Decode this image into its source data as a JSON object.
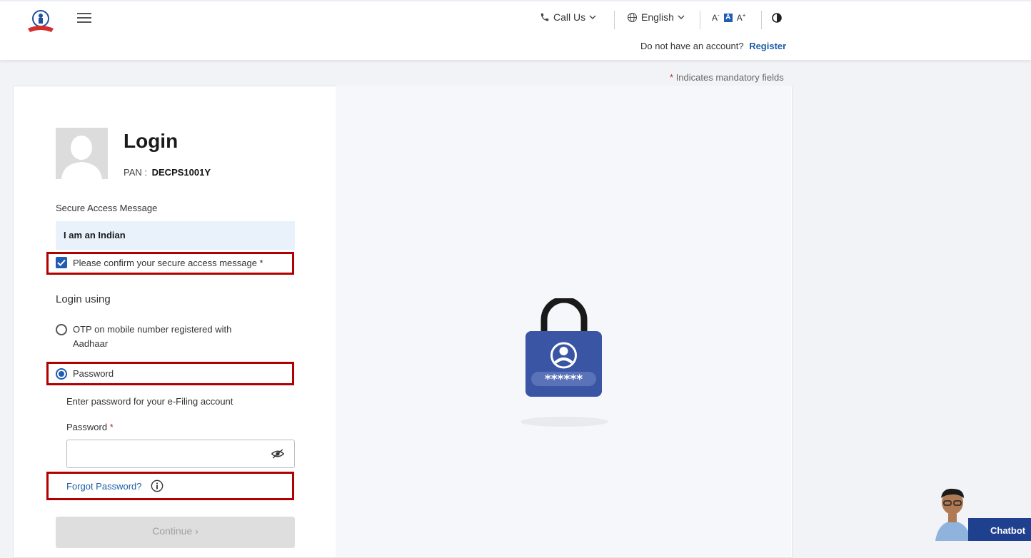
{
  "header": {
    "call_us": "Call Us",
    "language": "English",
    "font_decrease": "A",
    "font_default": "A",
    "font_increase": "A",
    "no_account_text": "Do not have an account?",
    "register_link": "Register"
  },
  "mandatory_note": {
    "star": "*",
    "text": "Indicates mandatory fields"
  },
  "login": {
    "title": "Login",
    "pan_label": "PAN :",
    "pan_value": "DECPS1001Y",
    "secure_access_label": "Secure Access Message",
    "secure_access_message": "I am an Indian",
    "confirm_label": "Please confirm your secure access message *",
    "confirm_checked": true,
    "login_using_label": "Login using",
    "option_otp": "OTP on mobile number registered with Aadhaar",
    "option_password": "Password",
    "selected_option": "Password",
    "enter_password_hint": "Enter password for your e-Filing account",
    "password_label": "Password",
    "password_required": "*",
    "password_value": "",
    "forgot_password": "Forgot Password?",
    "continue_button": "Continue ›"
  },
  "illustration": {
    "password_mask": "******"
  },
  "chatbot": {
    "label": "Chatbot"
  },
  "colors": {
    "brand_blue": "#1f5cb4",
    "link_blue": "#1d5ea8",
    "highlight_red": "#b00000",
    "required_red": "#c62828"
  }
}
